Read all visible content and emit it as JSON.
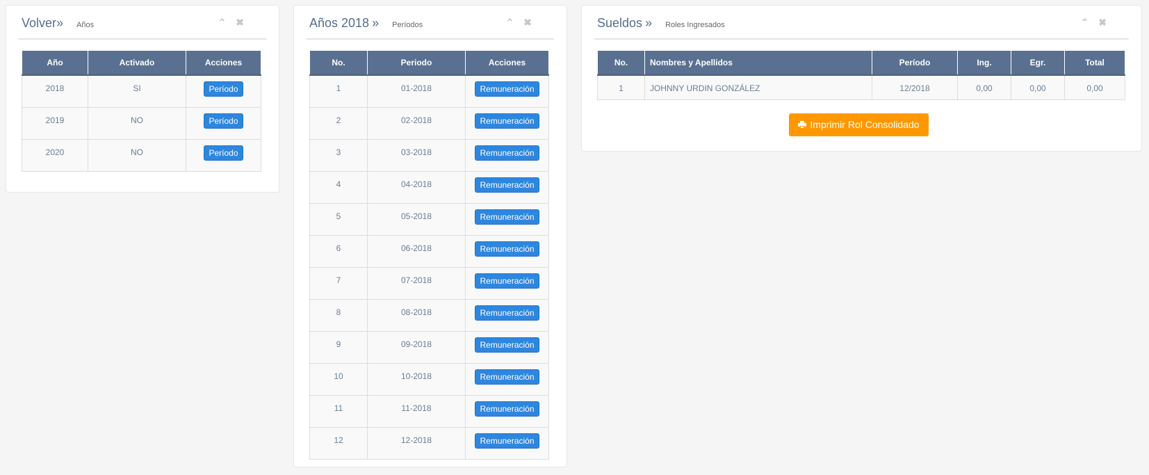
{
  "years_panel": {
    "title": "Volver",
    "sep": "»",
    "subtitle": "Años",
    "collapse_icon": "chevron-up-icon",
    "close_icon": "close-icon",
    "headers": [
      "Año",
      "Activado",
      "Acciones"
    ],
    "rows": [
      {
        "year": "2018",
        "active": "SI",
        "action": "Período"
      },
      {
        "year": "2019",
        "active": "NO",
        "action": "Período"
      },
      {
        "year": "2020",
        "active": "NO",
        "action": "Período"
      }
    ]
  },
  "periods_panel": {
    "title": "Años 2018",
    "sep": "»",
    "subtitle": "Períodos",
    "headers": [
      "No.",
      "Periodo",
      "Acciones"
    ],
    "rows": [
      {
        "no": "1",
        "period": "01-2018",
        "action": "Remuneración"
      },
      {
        "no": "2",
        "period": "02-2018",
        "action": "Remuneración"
      },
      {
        "no": "3",
        "period": "03-2018",
        "action": "Remuneración"
      },
      {
        "no": "4",
        "period": "04-2018",
        "action": "Remuneración"
      },
      {
        "no": "5",
        "period": "05-2018",
        "action": "Remuneración"
      },
      {
        "no": "6",
        "period": "06-2018",
        "action": "Remuneración"
      },
      {
        "no": "7",
        "period": "07-2018",
        "action": "Remuneración"
      },
      {
        "no": "8",
        "period": "08-2018",
        "action": "Remuneración"
      },
      {
        "no": "9",
        "period": "09-2018",
        "action": "Remuneración"
      },
      {
        "no": "10",
        "period": "10-2018",
        "action": "Remuneración"
      },
      {
        "no": "11",
        "period": "11-2018",
        "action": "Remuneración"
      },
      {
        "no": "12",
        "period": "12-2018",
        "action": "Remuneración"
      }
    ]
  },
  "roles_panel": {
    "title": "Sueldos",
    "sep": "»",
    "subtitle": "Roles Ingresados",
    "headers": [
      "No.",
      "Nombres y Apellidos",
      "Período",
      "Ing.",
      "Egr.",
      "Total"
    ],
    "rows": [
      {
        "no": "1",
        "name": "JOHNNY URDIN GONZÁLEZ",
        "period": "12/2018",
        "ing": "0,00",
        "egr": "0,00",
        "total": "0,00"
      }
    ],
    "print_button": "Imprimir Rol Consolidado",
    "print_icon": "printer-icon"
  },
  "colors": {
    "header_bg": "#5a7090",
    "primary_button": "#2e86de",
    "print_button": "#ff9800",
    "title_text": "#546e8c"
  }
}
